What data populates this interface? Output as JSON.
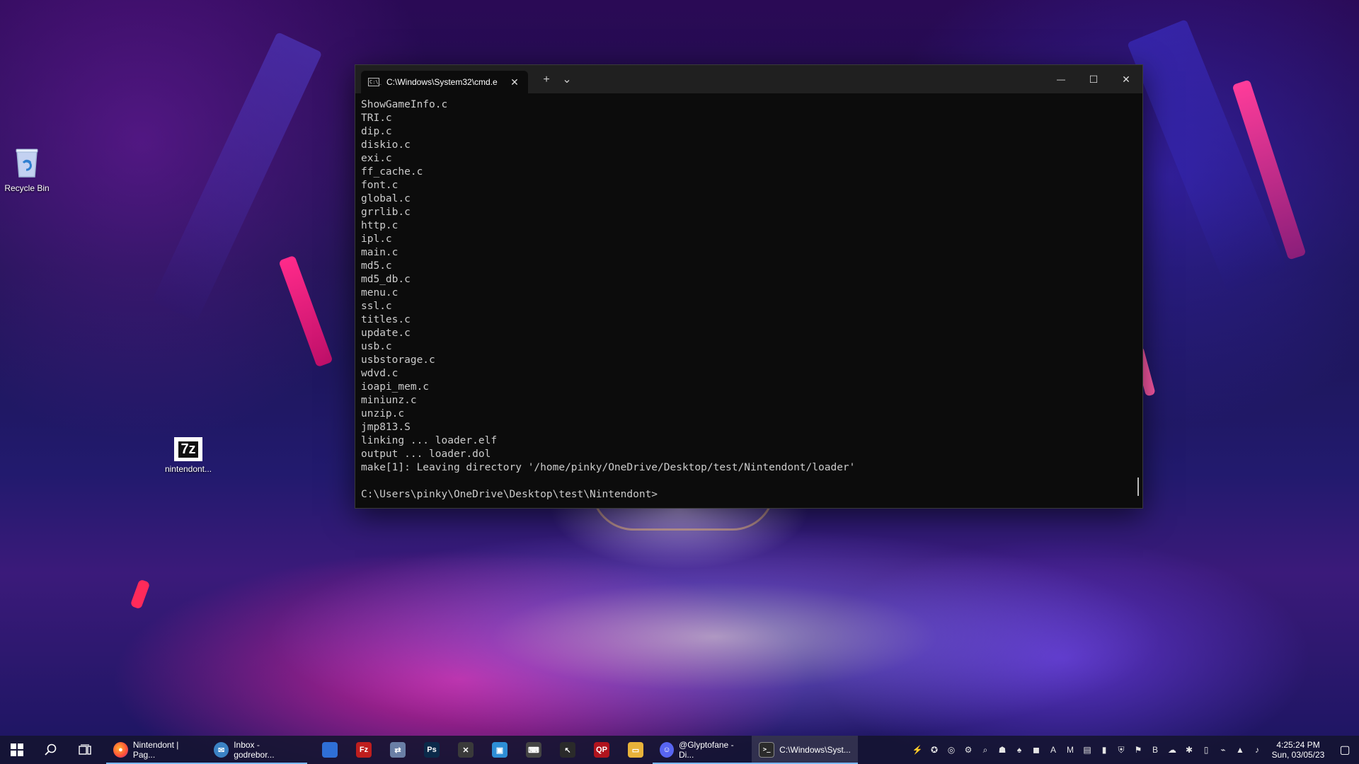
{
  "desktop": {
    "icons": [
      {
        "label": "Recycle Bin",
        "icon": "recycle-bin-icon"
      },
      {
        "label": "nintendont...",
        "icon": "7z-archive-icon",
        "glyph": "7z"
      }
    ]
  },
  "terminal": {
    "tab_title": "C:\\Windows\\System32\\cmd.e",
    "tab_icon_glyph": "C:\\_",
    "tab_close": "✕",
    "new_tab": "+",
    "dropdown": "⌄",
    "minimize": "—",
    "maximize": "☐",
    "close": "✕",
    "output": [
      "ShowGameInfo.c",
      "TRI.c",
      "dip.c",
      "diskio.c",
      "exi.c",
      "ff_cache.c",
      "font.c",
      "global.c",
      "grrlib.c",
      "http.c",
      "ipl.c",
      "main.c",
      "md5.c",
      "md5_db.c",
      "menu.c",
      "ssl.c",
      "titles.c",
      "update.c",
      "usb.c",
      "usbstorage.c",
      "wdvd.c",
      "ioapi_mem.c",
      "miniunz.c",
      "unzip.c",
      "jmp813.S",
      "linking ... loader.elf",
      "output ... loader.dol",
      "make[1]: Leaving directory '/home/pinky/OneDrive/Desktop/test/Nintendont/loader'",
      "",
      "C:\\Users\\pinky\\OneDrive\\Desktop\\test\\Nintendont>"
    ]
  },
  "taskbar": {
    "start_icon": "windows-start-icon",
    "search_icon": "search-icon",
    "task_view_icon": "task-view-icon",
    "apps": [
      {
        "name": "firefox",
        "label": "Nintendont | Pag...",
        "color": "#ff7a1a",
        "glyph": "●"
      },
      {
        "name": "thunderbird",
        "label": "Inbox - godrebor...",
        "color": "#3b82c4",
        "glyph": "✉"
      }
    ],
    "pinned": [
      {
        "name": "blue-app",
        "color": "#2f6fd6",
        "glyph": ""
      },
      {
        "name": "filezilla",
        "color": "#bf1e1e",
        "glyph": "Fz"
      },
      {
        "name": "network-app",
        "color": "#6a7fa6",
        "glyph": "⇄"
      },
      {
        "name": "photoshop",
        "color": "#0b2a4a",
        "glyph": "Ps"
      },
      {
        "name": "x-app",
        "color": "#3a3a3a",
        "glyph": "✕"
      },
      {
        "name": "image-app",
        "color": "#2d8ed6",
        "glyph": "▣"
      },
      {
        "name": "keyboard-app",
        "color": "#444444",
        "glyph": "⌨"
      },
      {
        "name": "cursor-app",
        "color": "#2a2a2a",
        "glyph": "↖"
      },
      {
        "name": "qp-app",
        "color": "#b0141e",
        "glyph": "QP"
      },
      {
        "name": "file-explorer",
        "color": "#e8b23a",
        "glyph": "▭"
      }
    ],
    "running": [
      {
        "name": "discord",
        "label": "@Glyptofane - Di...",
        "color": "#5865f2",
        "glyph": "☺"
      },
      {
        "name": "terminal",
        "label": "C:\\Windows\\Syst...",
        "color": "#2b2b2b",
        "glyph": ">_"
      }
    ],
    "tray_icons": [
      "⚡",
      "✪",
      "◎",
      "⚙",
      "⌕",
      "☗",
      "♠",
      "◼",
      "A",
      "M",
      "▤",
      "▮",
      "⛨",
      "⚑",
      "B",
      "☁",
      "✱",
      "▯",
      "⌁",
      "▲",
      "♪"
    ],
    "clock_time": "4:25:24 PM",
    "clock_date": "Sun, 03/05/23",
    "notification_icon": "▢"
  }
}
